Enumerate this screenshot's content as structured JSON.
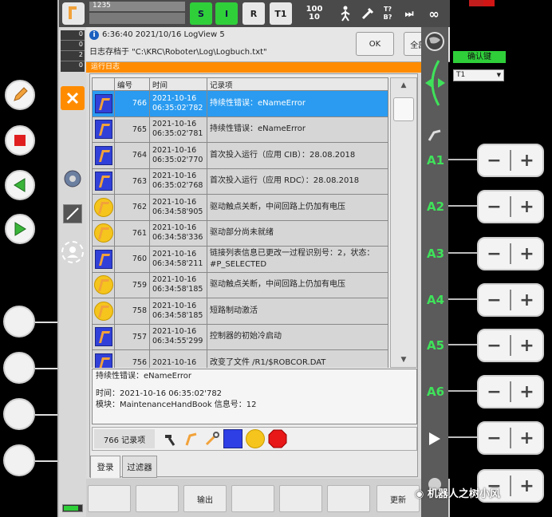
{
  "left_panel": {
    "buttons": [
      {
        "name": "edit-button"
      },
      {
        "name": "stop-button"
      },
      {
        "name": "back-button"
      },
      {
        "name": "play-button"
      }
    ]
  },
  "topbar": {
    "program_name": "1235",
    "s_label": "S",
    "i_label": "I",
    "r_label": "R",
    "t1_label": "T1",
    "run_value": "100",
    "step_value": "10",
    "t_value": "T?",
    "b_value": "B?",
    "infinity": "∞"
  },
  "status_counts": [
    "0",
    "0",
    "2",
    "0"
  ],
  "message": {
    "timestamp": "6:36:40 2021/10/16 LogView 5",
    "text": "日志存档于 \"C:\\KRC\\Roboter\\Log\\Logbuch.txt\"",
    "ok_label": "OK",
    "all_ok_label": "全部 OK"
  },
  "window_title": "运行日志",
  "table": {
    "headers": [
      "编号",
      "时间",
      "记录项"
    ],
    "rows": [
      {
        "icon": "blue",
        "num": "766",
        "date": "2021-10-16",
        "time": "06:35:02'782",
        "msg": "持续性错误：eNameError",
        "selected": true
      },
      {
        "icon": "blue",
        "num": "765",
        "date": "2021-10-16",
        "time": "06:35:02'781",
        "msg": "持续性错误：eNameError",
        "selected": false
      },
      {
        "icon": "blue",
        "num": "764",
        "date": "2021-10-16",
        "time": "06:35:02'770",
        "msg": "首次投入运行（应用 CIB）：28.08.2018",
        "selected": false
      },
      {
        "icon": "blue",
        "num": "763",
        "date": "2021-10-16",
        "time": "06:35:02'768",
        "msg": "首次投入运行（应用 RDC）：28.08.2018",
        "selected": false
      },
      {
        "icon": "yellow",
        "num": "762",
        "date": "2021-10-16",
        "time": "06:34:58'905",
        "msg": "驱动触点关断，中间回路上仍加有电压",
        "selected": false
      },
      {
        "icon": "yellow",
        "num": "761",
        "date": "2021-10-16",
        "time": "06:34:58'336",
        "msg": "驱动部分尚未就绪",
        "selected": false
      },
      {
        "icon": "blue",
        "num": "760",
        "date": "2021-10-16",
        "time": "06:34:58'211",
        "msg": "链接列表信息已更改一过程识别号：2，状态：#P_SELECTED",
        "selected": false
      },
      {
        "icon": "yellow",
        "num": "759",
        "date": "2021-10-16",
        "time": "06:34:58'185",
        "msg": "驱动触点关断，中间回路上仍加有电压",
        "selected": false
      },
      {
        "icon": "yellow",
        "num": "758",
        "date": "2021-10-16",
        "time": "06:34:58'185",
        "msg": "短路制动激活",
        "selected": false
      },
      {
        "icon": "blue",
        "num": "757",
        "date": "2021-10-16",
        "time": "06:34:55'299",
        "msg": "控制器的初始冷启动",
        "selected": false
      },
      {
        "icon": "blue",
        "num": "756",
        "date": "2021-10-16",
        "time": "",
        "msg": "改变了文件 /R1/$ROBCOR.DAT",
        "selected": false
      }
    ]
  },
  "detail": {
    "line1": "持续性错误：eNameError",
    "line2": "时间：2021-10-16 06:35:02'782",
    "line3": "模块：MaintenanceHandBook  信息号：12"
  },
  "filter_count": "766 记录项",
  "tabs": {
    "login": "登录",
    "filter": "过滤器"
  },
  "bottom_buttons": {
    "export": "输出",
    "refresh": "更新"
  },
  "right_panel": {
    "confirm_label": "确认键",
    "mode_value": "T1",
    "axes": [
      "A1",
      "A2",
      "A3",
      "A4",
      "A5",
      "A6"
    ]
  },
  "watermark": "机器人之树小风",
  "colors": {
    "accent": "#ff8c00",
    "selected": "#2a9bf0",
    "green": "#2fcf3a"
  }
}
